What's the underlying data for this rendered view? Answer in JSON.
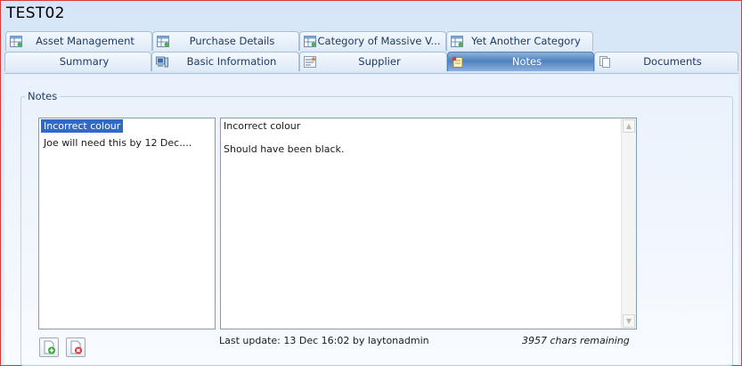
{
  "window": {
    "title": "TEST02"
  },
  "tabs_row1": [
    {
      "label": "Asset Management",
      "icon": "grid-table-icon"
    },
    {
      "label": "Purchase Details",
      "icon": "grid-table-icon"
    },
    {
      "label": "Category of Massive V...",
      "icon": "grid-table-icon"
    },
    {
      "label": "Yet Another Category",
      "icon": "grid-table-icon"
    }
  ],
  "tabs_row2": [
    {
      "label": "Summary",
      "icon": ""
    },
    {
      "label": "Basic Information",
      "icon": "computer-icon"
    },
    {
      "label": "Supplier",
      "icon": "supplier-icon"
    },
    {
      "label": "Notes",
      "icon": "notepad-icon",
      "active": true
    },
    {
      "label": "Documents",
      "icon": "documents-icon"
    }
  ],
  "notes": {
    "group_label": "Notes",
    "list": [
      {
        "label": "Incorrect colour",
        "selected": true
      },
      {
        "label": "Joe will need this by 12 Dec....",
        "selected": false
      }
    ],
    "content": {
      "line1": "Incorrect colour",
      "line2": "Should have been black."
    },
    "last_update": "Last update: 13 Dec 16:02 by laytonadmin",
    "chars_remaining": "3957 chars remaining"
  },
  "colors": {
    "active_tab": "#4f82c0",
    "selection": "#3169c6",
    "frame_border": "#d43c3c"
  }
}
